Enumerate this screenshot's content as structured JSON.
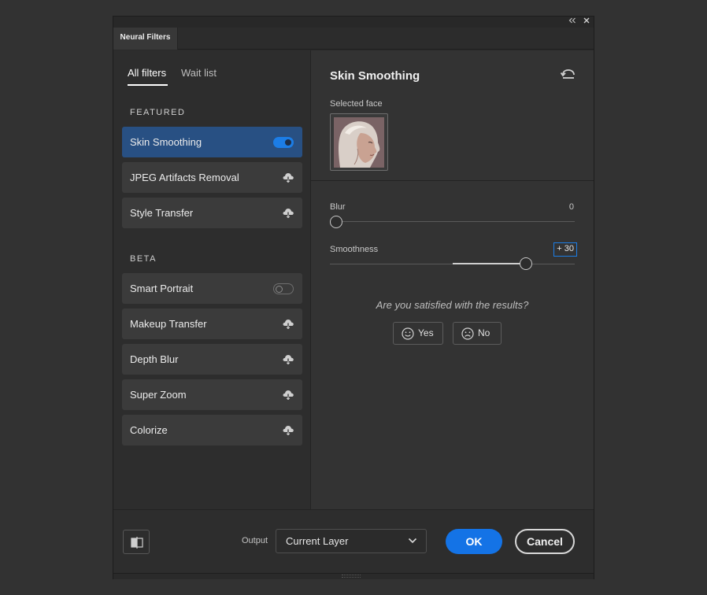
{
  "window": {
    "tab_title": "Neural Filters",
    "collapse_icon": "double-chevron-left",
    "close_icon": "close-x"
  },
  "filters_panel": {
    "tabs": [
      {
        "label": "All filters",
        "active": true
      },
      {
        "label": "Wait list",
        "active": false
      }
    ],
    "sections": [
      {
        "label": "FEATURED",
        "items": [
          {
            "label": "Skin Smoothing",
            "control": "toggle-on",
            "selected": true
          },
          {
            "label": "JPEG Artifacts Removal",
            "control": "cloud-download-icon"
          },
          {
            "label": "Style Transfer",
            "control": "cloud-download-icon"
          }
        ]
      },
      {
        "label": "BETA",
        "items": [
          {
            "label": "Smart Portrait",
            "control": "toggle-off"
          },
          {
            "label": "Makeup Transfer",
            "control": "cloud-download-icon"
          },
          {
            "label": "Depth Blur",
            "control": "cloud-download-icon"
          },
          {
            "label": "Super Zoom",
            "control": "cloud-download-icon"
          },
          {
            "label": "Colorize",
            "control": "cloud-download-icon"
          }
        ]
      }
    ]
  },
  "settings_panel": {
    "title": "Skin Smoothing",
    "reset_icon": "reset-arrow",
    "selected_face_label": "Selected face",
    "sliders": [
      {
        "label": "Blur",
        "value_text": "0",
        "value": 0,
        "min": 0,
        "max": 100
      },
      {
        "label": "Smoothness",
        "value_text": "+ 30",
        "value": 30,
        "min": -50,
        "max": 50
      }
    ],
    "feedback": {
      "question": "Are you satisfied with the results?",
      "yes_label": "Yes",
      "no_label": "No"
    }
  },
  "footer": {
    "output_label": "Output",
    "output_value": "Current Layer",
    "ok_label": "OK",
    "cancel_label": "Cancel"
  },
  "colors": {
    "accent": "#1473e6",
    "selected_item": "#285083"
  }
}
